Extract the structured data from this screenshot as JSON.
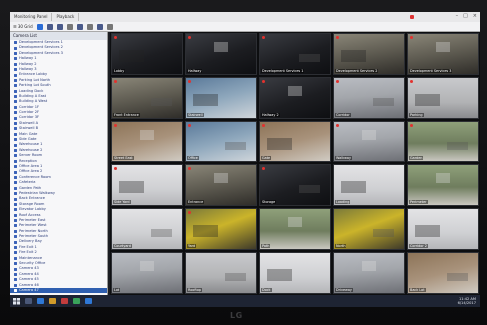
{
  "window": {
    "tabs": [
      "Monitoring Panel",
      "Playback"
    ],
    "controls": [
      "–",
      "□",
      "×"
    ]
  },
  "toolbar": {
    "view_label": "☰ 30 Grid"
  },
  "sidebar": {
    "header": "Camera List",
    "items": [
      "Development Services 1",
      "Development Services 2",
      "Development Services 3",
      "Hallway 1",
      "Hallway 2",
      "Hallway 3",
      "Entrance Lobby",
      "Parking Lot North",
      "Parking Lot South",
      "Loading Dock",
      "Building A East",
      "Building A West",
      "Corridor 1F",
      "Corridor 2F",
      "Corridor 3F",
      "Stairwell A",
      "Stairwell B",
      "Main Gate",
      "Side Gate",
      "Warehouse 1",
      "Warehouse 2",
      "Server Room",
      "Reception",
      "Office Area 1",
      "Office Area 2",
      "Conference Room",
      "Cafeteria",
      "Garden Path",
      "Pedestrian Walkway",
      "Back Entrance",
      "Storage Room",
      "Elevator Lobby",
      "Roof Access",
      "Perimeter East",
      "Perimeter West",
      "Perimeter North",
      "Perimeter South",
      "Delivery Bay",
      "Fire Exit 1",
      "Fire Exit 2",
      "Maintenance",
      "Security Office",
      "Camera 43",
      "Camera 44",
      "Camera 45",
      "Camera 46",
      "Camera 47"
    ],
    "selected_index": 46
  },
  "cameras": [
    {
      "label": "Lobby",
      "view": "v-dark",
      "rec": true
    },
    {
      "label": "Hallway",
      "view": "v-dark",
      "rec": true
    },
    {
      "label": "Development Services 1",
      "view": "v-dark",
      "rec": true
    },
    {
      "label": "Development Services 2",
      "view": "v-indoor",
      "rec": true
    },
    {
      "label": "Development Services 3",
      "view": "v-indoor",
      "rec": true
    },
    {
      "label": "Front Entrance",
      "view": "v-indoor",
      "rec": true
    },
    {
      "label": "Stairwell",
      "view": "v-blue",
      "rec": true
    },
    {
      "label": "Hallway 2",
      "view": "v-dark",
      "rec": true
    },
    {
      "label": "Corridor",
      "view": "v-street",
      "rec": true
    },
    {
      "label": "Parking",
      "view": "v-lot",
      "rec": true
    },
    {
      "label": "Street East",
      "view": "v-brown",
      "rec": true
    },
    {
      "label": "Office",
      "view": "v-blue",
      "rec": true
    },
    {
      "label": "Gate",
      "view": "v-brown",
      "rec": true
    },
    {
      "label": "Walkway",
      "view": "v-street",
      "rec": true
    },
    {
      "label": "Garden",
      "view": "v-green",
      "rec": true
    },
    {
      "label": "Side Yard",
      "view": "v-light",
      "rec": true
    },
    {
      "label": "Entrance",
      "view": "v-indoor",
      "rec": true
    },
    {
      "label": "Storage",
      "view": "v-dark",
      "rec": true
    },
    {
      "label": "Loading",
      "view": "v-light",
      "rec": false
    },
    {
      "label": "Perimeter",
      "view": "v-green",
      "rec": false
    },
    {
      "label": "Courtyard",
      "view": "v-light",
      "rec": false
    },
    {
      "label": "Yard",
      "view": "v-yellow",
      "rec": true
    },
    {
      "label": "Path",
      "view": "v-green",
      "rec": false
    },
    {
      "label": "North",
      "view": "v-yellow",
      "rec": false
    },
    {
      "label": "Corridor 2",
      "view": "v-light",
      "rec": false
    },
    {
      "label": "Lot",
      "view": "v-street",
      "rec": false
    },
    {
      "label": "Rooftop",
      "view": "v-lot",
      "rec": false
    },
    {
      "label": "Dock",
      "view": "v-light",
      "rec": false
    },
    {
      "label": "Driveway",
      "view": "v-street",
      "rec": false
    },
    {
      "label": "Back Lot",
      "view": "v-brown",
      "rec": false
    }
  ],
  "taskbar": {
    "time": "11:42 AM",
    "date": "6/14/2017"
  },
  "monitor": {
    "brand": "LG"
  }
}
